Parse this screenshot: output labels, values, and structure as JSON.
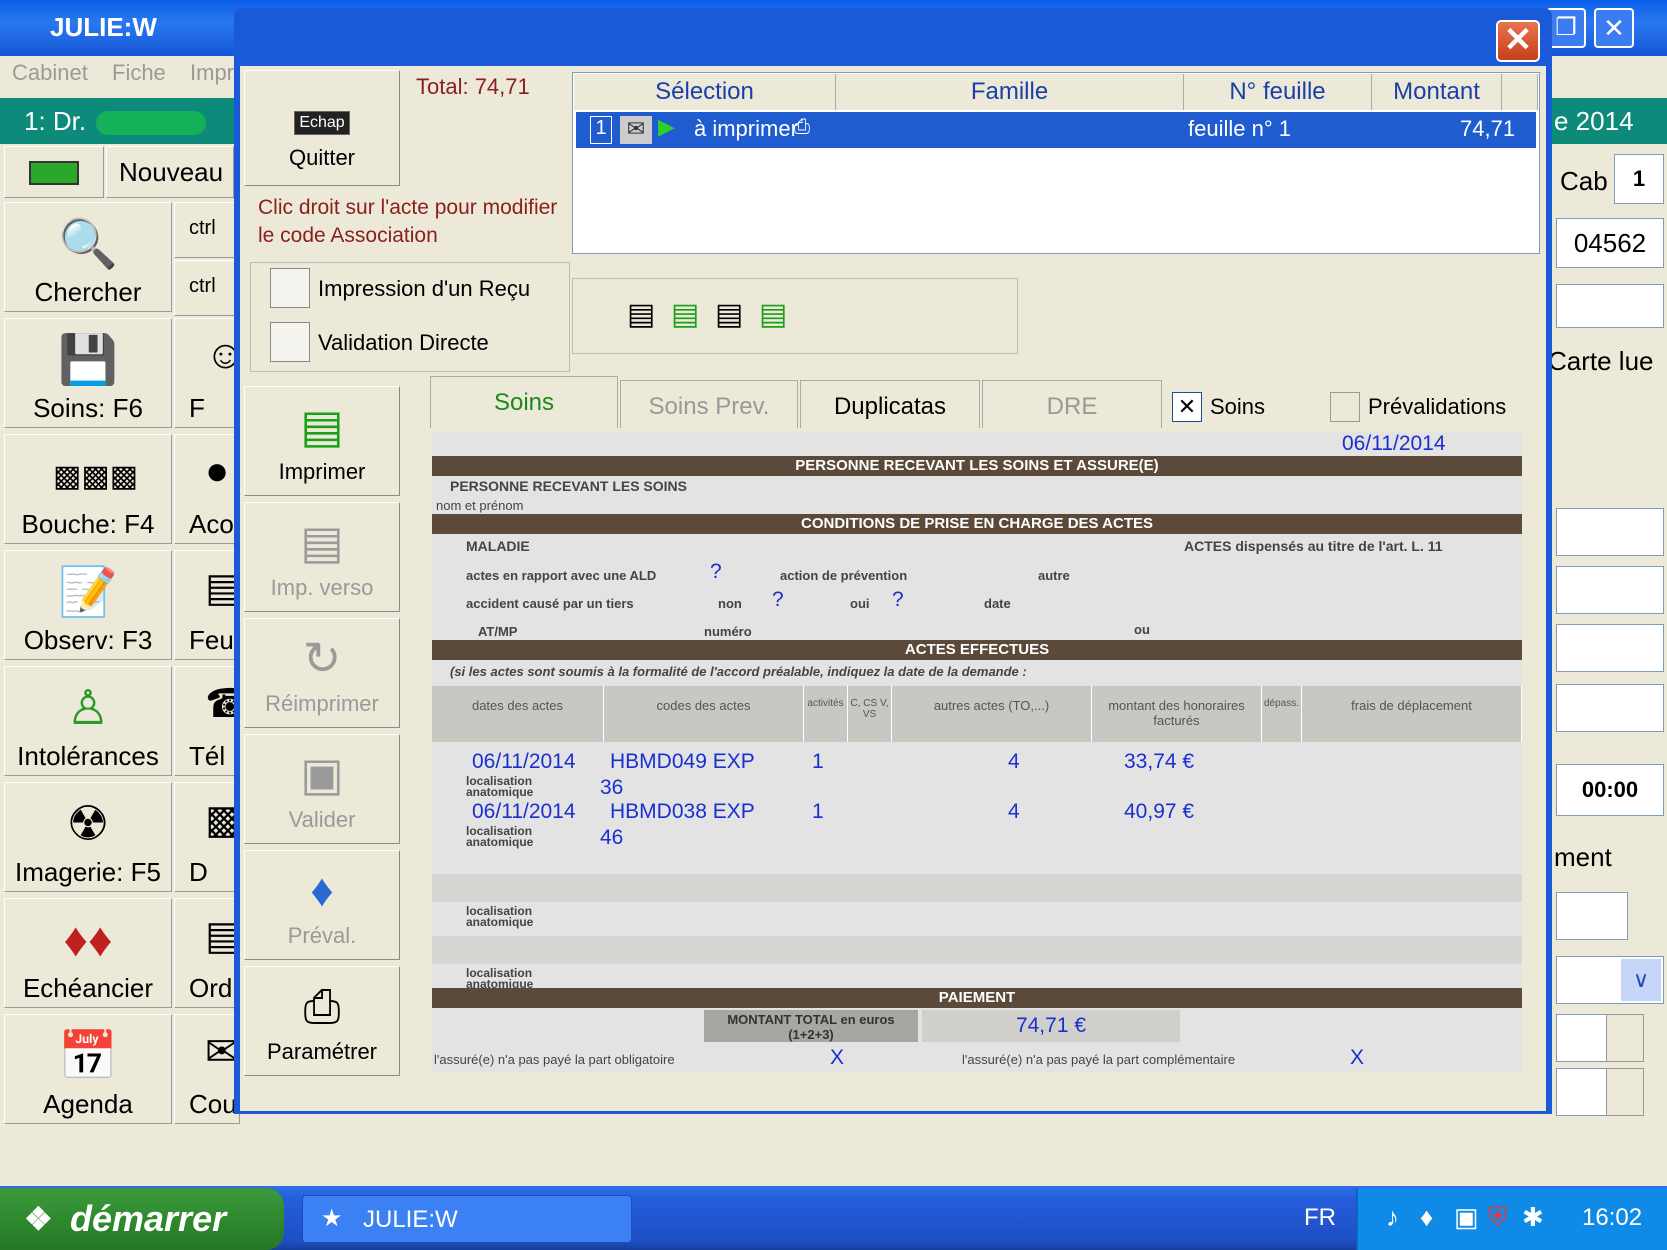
{
  "app": {
    "title": "JULIE:W",
    "menu": [
      "Cabinet",
      "Fiche",
      "Impr"
    ],
    "doctor": "1: Dr.",
    "year_fragment": "e 2014",
    "cab_label": "Cab",
    "cab_value": "1",
    "patient_id": "04562",
    "carte_lue": "Carte lue",
    "time": "00:00",
    "ment": "ment"
  },
  "toolbar": {
    "nouveau": "Nouveau",
    "ctrl1": "ctrl",
    "ctrl2": "ctrl"
  },
  "left_buttons": [
    {
      "label": "Chercher",
      "icon": "magnifier-icon"
    },
    {
      "label": "Soins: F6",
      "icon": "tooth-tools-icon"
    },
    {
      "label": "Bouche: F4",
      "icon": "teeth-icon"
    },
    {
      "label": "Observ: F3",
      "icon": "notepad-icon"
    },
    {
      "label": "Intolérances",
      "icon": "bottle-icon"
    },
    {
      "label": "Imagerie: F5",
      "icon": "xray-icon"
    },
    {
      "label": "Echéancier",
      "icon": "cards-icon"
    },
    {
      "label": "Agenda",
      "icon": "calendar-icon"
    }
  ],
  "left_col2": [
    "F",
    "Aco",
    "Feui",
    "Tél",
    "D",
    "Ord",
    "Cou"
  ],
  "dialog": {
    "total": "Total: 74,71",
    "escape_key": "Echap",
    "quit": "Quitter",
    "hint": "Clic droit sur l'acte pour modifier le code Association",
    "columns": [
      "Sélection",
      "Famille",
      "N° feuille",
      "Montant"
    ],
    "row": {
      "num": "1",
      "selection": "à imprimer",
      "feuille": "feuille n° 1",
      "montant": "74,71"
    },
    "receipt": "Impression d'un Reçu",
    "direct": "Validation Directe",
    "side_buttons": [
      {
        "label": "Imprimer",
        "enabled": true
      },
      {
        "label": "Imp. verso",
        "enabled": false
      },
      {
        "label": "Réimprimer",
        "enabled": false
      },
      {
        "label": "Valider",
        "enabled": false
      },
      {
        "label": "Préval.",
        "enabled": false
      },
      {
        "label": "Paramétrer",
        "enabled": true
      }
    ],
    "tabs": [
      "Soins",
      "Soins Prev.",
      "Duplicatas",
      "DRE"
    ],
    "soins_check": "Soins",
    "prevalidations": "Prévalidations"
  },
  "form": {
    "date": "06/11/2014",
    "band1": "PERSONNE RECEVANT LES SOINS ET ASSURE(E)",
    "person_label": "PERSONNE RECEVANT LES SOINS",
    "nom": "nom et prénom",
    "band2": "CONDITIONS DE PRISE EN CHARGE DES ACTES",
    "maladie": "MALADIE",
    "actes_art": "ACTES dispensés au titre de l'art. L. 11",
    "ald": "actes en rapport avec une ALD",
    "prevention": "action de prévention",
    "autre": "autre",
    "accident": "accident causé par un tiers",
    "non": "non",
    "oui": "oui",
    "date_lbl": "date",
    "atmp": "AT/MP",
    "numero": "numéro",
    "ou": "ou",
    "band3": "ACTES EFFECTUES",
    "accord": "(si les actes sont soumis à la formalité de l'accord préalable, indiquez la date de la demande :",
    "headers": [
      "dates des actes",
      "codes des actes",
      "activités",
      "C, CS V, VS",
      "autres actes (TO,...)",
      "montant des honoraires facturés",
      "dépass.",
      "frais de déplacement"
    ],
    "rows": [
      {
        "date": "06/11/2014",
        "code": "HBMD049 EXP",
        "act": "1",
        "mod": "4",
        "montant": "33,74 €",
        "loc": "36"
      },
      {
        "date": "06/11/2014",
        "code": "HBMD038 EXP",
        "act": "1",
        "mod": "4",
        "montant": "40,97 €",
        "loc": "46"
      }
    ],
    "localisation": "localisation anatomique",
    "band4": "PAIEMENT",
    "montant_total_lbl": "MONTANT TOTAL en euros (1+2+3)",
    "montant_total": "74,71 €",
    "oblig": "l'assuré(e) n'a pas payé la part obligatoire",
    "compl": "l'assuré(e) n'a pas payé la part complémentaire",
    "x": "X",
    "q": "?"
  },
  "taskbar": {
    "start": "démarrer",
    "task": "JULIE:W",
    "lang": "FR",
    "clock": "16:02"
  }
}
